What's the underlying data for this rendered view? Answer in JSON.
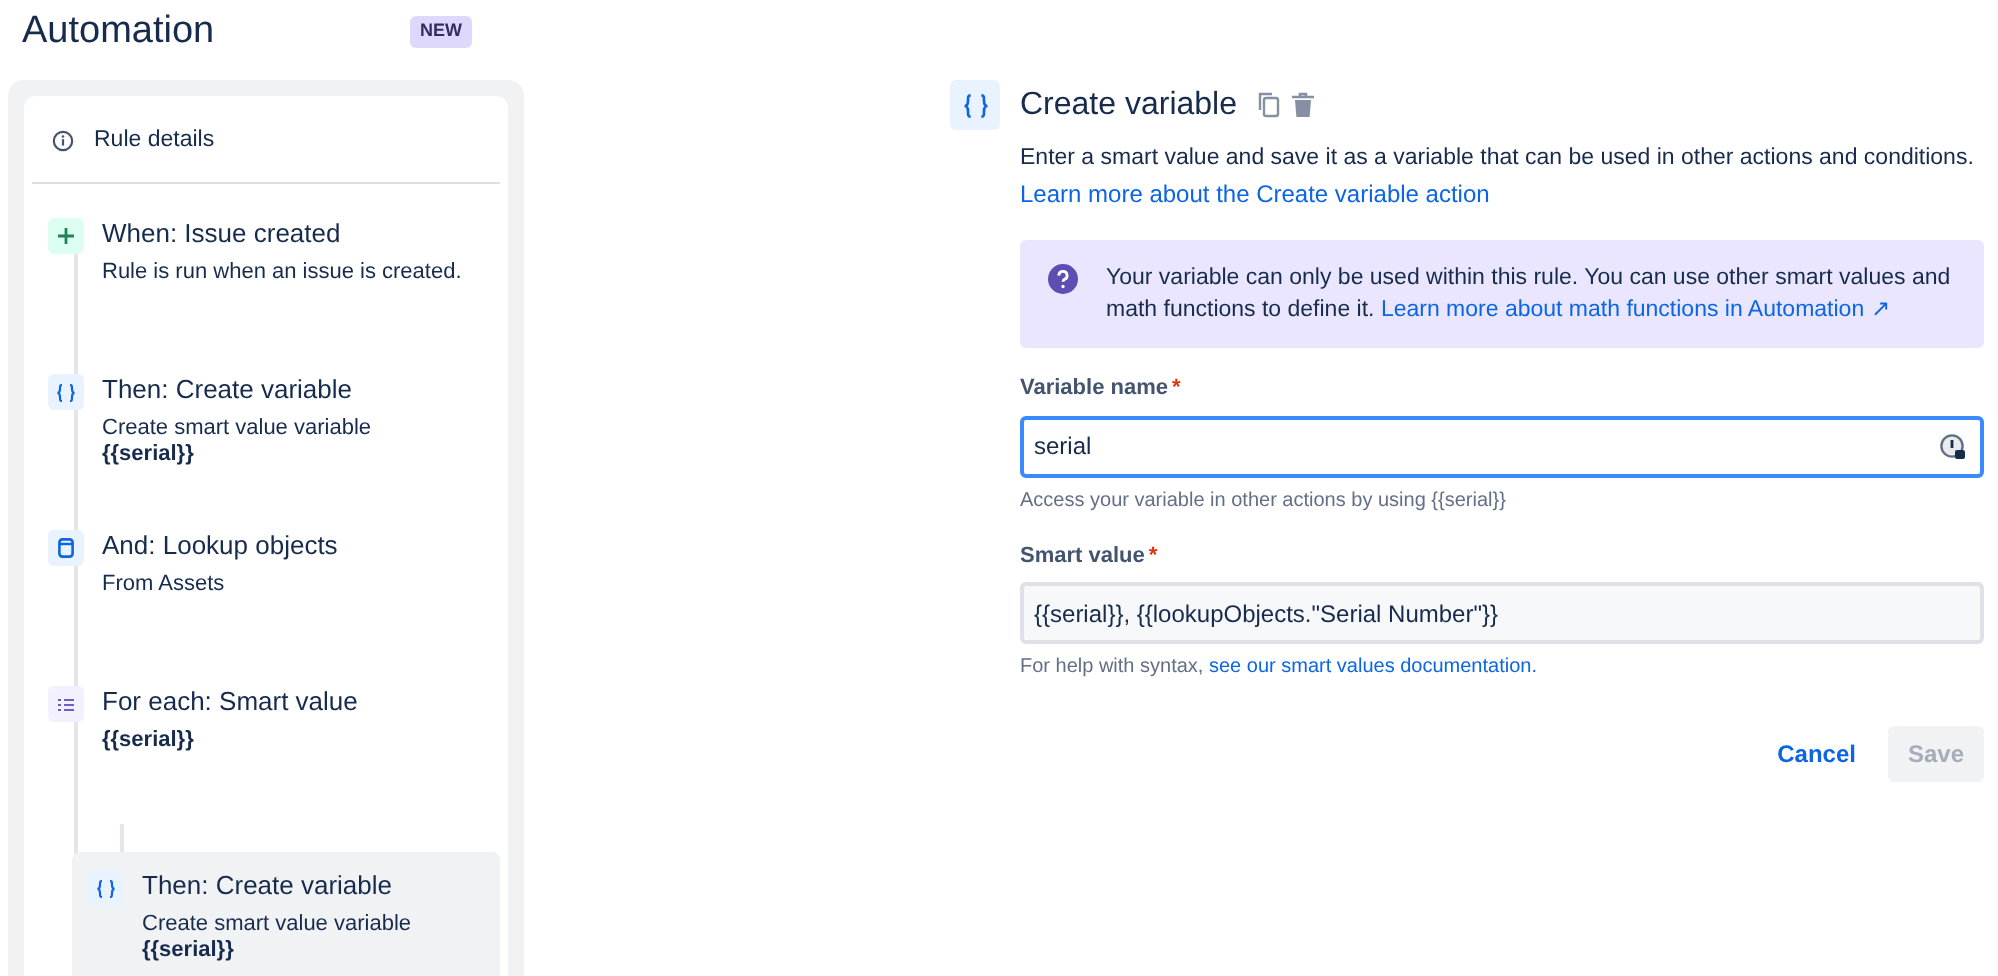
{
  "header": {
    "title": "Automation",
    "badge": "NEW"
  },
  "sidebar": {
    "rule_details": "Rule details",
    "steps": [
      {
        "kind": "trigger",
        "title": "When: Issue created",
        "detail": "Rule is run when an issue is created.",
        "selected": false
      },
      {
        "kind": "variable",
        "title": "Then: Create variable",
        "detail": "Create smart value variable",
        "value": "{{serial}}",
        "selected": false
      },
      {
        "kind": "lookup",
        "title": "And: Lookup objects",
        "detail": "From Assets",
        "selected": false
      },
      {
        "kind": "foreach",
        "title": "For each: Smart value",
        "value": "{{serial}}",
        "selected": false,
        "children": [
          {
            "kind": "variable",
            "title": "Then: Create variable",
            "detail": "Create smart value variable",
            "value": "{{serial}}",
            "selected": true
          }
        ]
      }
    ]
  },
  "editor": {
    "title": "Create variable",
    "description": "Enter a smart value and save it as a variable that can be used in other actions and conditions.",
    "learn_link": "Learn more about the Create variable action",
    "info": {
      "text": "Your variable can only be used within this rule. You can use other smart values and math functions to define it.",
      "link": "Learn more about math functions in Automation ↗"
    },
    "fields": [
      {
        "label": "Variable name",
        "required_mark": "*",
        "value": "serial",
        "focused": true,
        "help": "Access your variable in other actions by using {{serial}}"
      },
      {
        "label": "Smart value",
        "required_mark": "*",
        "value": "{{serial}}, {{lookupObjects.\"Serial Number\"}}",
        "focused": false,
        "help": "For help with syntax,",
        "help_link": "see our smart values documentation."
      }
    ],
    "buttons": [
      {
        "label": "Cancel",
        "kind": "link",
        "disabled": false
      },
      {
        "label": "Save",
        "kind": "primary",
        "disabled": true
      }
    ]
  }
}
